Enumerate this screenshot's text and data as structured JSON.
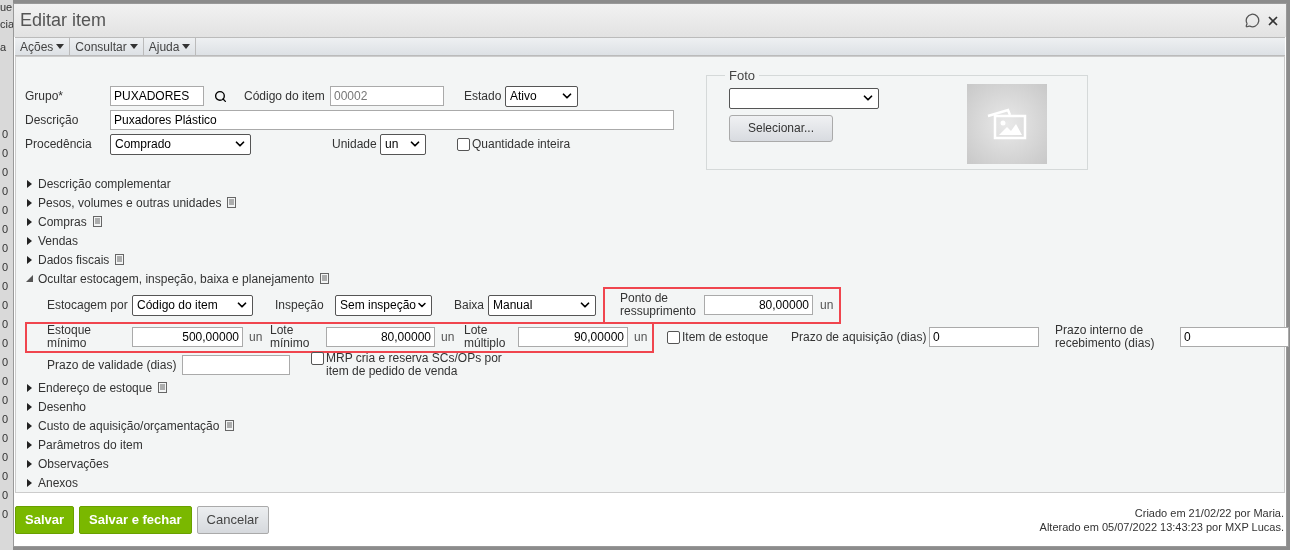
{
  "background_window": {
    "fragments": [
      "ue",
      "cia",
      "a"
    ],
    "rows": [
      "0",
      "0",
      "0",
      "0",
      "0",
      "0",
      "0",
      "0",
      "0",
      "0",
      "0",
      "0",
      "0",
      "0",
      "0",
      "0",
      "0",
      "0",
      "0",
      "0",
      "0"
    ]
  },
  "dialog": {
    "title": "Editar item"
  },
  "menu": [
    {
      "label": "Ações"
    },
    {
      "label": "Consultar"
    },
    {
      "label": "Ajuda"
    }
  ],
  "form": {
    "grupo": {
      "label": "Grupo*",
      "value": "PUXADORES"
    },
    "codigo": {
      "label": "Código do item",
      "value": "00002",
      "disabled": true
    },
    "estado": {
      "label": "Estado",
      "value": "Ativo"
    },
    "descricao": {
      "label": "Descrição",
      "value": "Puxadores Plástico"
    },
    "procedencia": {
      "label": "Procedência",
      "value": "Comprado"
    },
    "unidade": {
      "label": "Unidade",
      "value": "un"
    },
    "quantidade_inteira": {
      "label": "Quantidade inteira",
      "checked": false
    }
  },
  "foto": {
    "legend": "Foto",
    "button": "Selecionar..."
  },
  "sections": [
    {
      "label": "Descrição complementar",
      "expanded": false,
      "notes": false
    },
    {
      "label": "Pesos, volumes e outras unidades",
      "expanded": false,
      "notes": true
    },
    {
      "label": "Compras",
      "expanded": false,
      "notes": true
    },
    {
      "label": "Vendas",
      "expanded": false,
      "notes": false
    },
    {
      "label": "Dados fiscais",
      "expanded": false,
      "notes": true
    },
    {
      "label": "Ocultar estocagem, inspeção, baixa e planejamento",
      "expanded": true,
      "notes": true
    },
    {
      "label": "Endereço de estoque",
      "expanded": false,
      "notes": true
    },
    {
      "label": "Desenho",
      "expanded": false,
      "notes": false
    },
    {
      "label": "Custo de aquisição/orçamentação",
      "expanded": false,
      "notes": true
    },
    {
      "label": "Parâmetros do item",
      "expanded": false,
      "notes": false
    },
    {
      "label": "Observações",
      "expanded": false,
      "notes": false
    },
    {
      "label": "Anexos",
      "expanded": false,
      "notes": false
    }
  ],
  "planning": {
    "estocagem": {
      "label": "Estocagem por",
      "value": "Código do item"
    },
    "inspecao": {
      "label": "Inspeção",
      "value": "Sem inspeção"
    },
    "baixa": {
      "label": "Baixa",
      "value": "Manual"
    },
    "ponto": {
      "label": "Ponto de ressuprimento",
      "value": "80,00000",
      "unit": "un",
      "highlighted": true
    },
    "minimums": {
      "highlighted": true,
      "fields": [
        {
          "label": "Estoque mínimo",
          "value": "500,00000",
          "unit": "un"
        },
        {
          "label": "Lote mínimo",
          "value": "80,00000",
          "unit": "un"
        },
        {
          "label": "Lote múltiplo",
          "value": "90,00000",
          "unit": "un"
        }
      ]
    },
    "item_estoque": {
      "label": "Item de estoque",
      "checked": false
    },
    "prazo_aquisicao": {
      "label": "Prazo de aquisição (dias)",
      "value": "0"
    },
    "prazo_interno": {
      "label": "Prazo interno de recebimento (dias)",
      "value": "0"
    },
    "prazo_validade": {
      "label": "Prazo de validade (dias)"
    },
    "mrp": {
      "label": "MRP cria e reserva SCs/OPs por item de pedido de venda",
      "checked": false
    }
  },
  "footer": {
    "buttons": [
      {
        "label": "Salvar",
        "kind": "primary"
      },
      {
        "label": "Salvar e fechar",
        "kind": "primary"
      },
      {
        "label": "Cancelar",
        "kind": "secondary"
      }
    ],
    "created": "Criado em 21/02/22 por Maria.",
    "modified": "Alterado em 05/07/2022 13:43:23 por MXP Lucas."
  }
}
